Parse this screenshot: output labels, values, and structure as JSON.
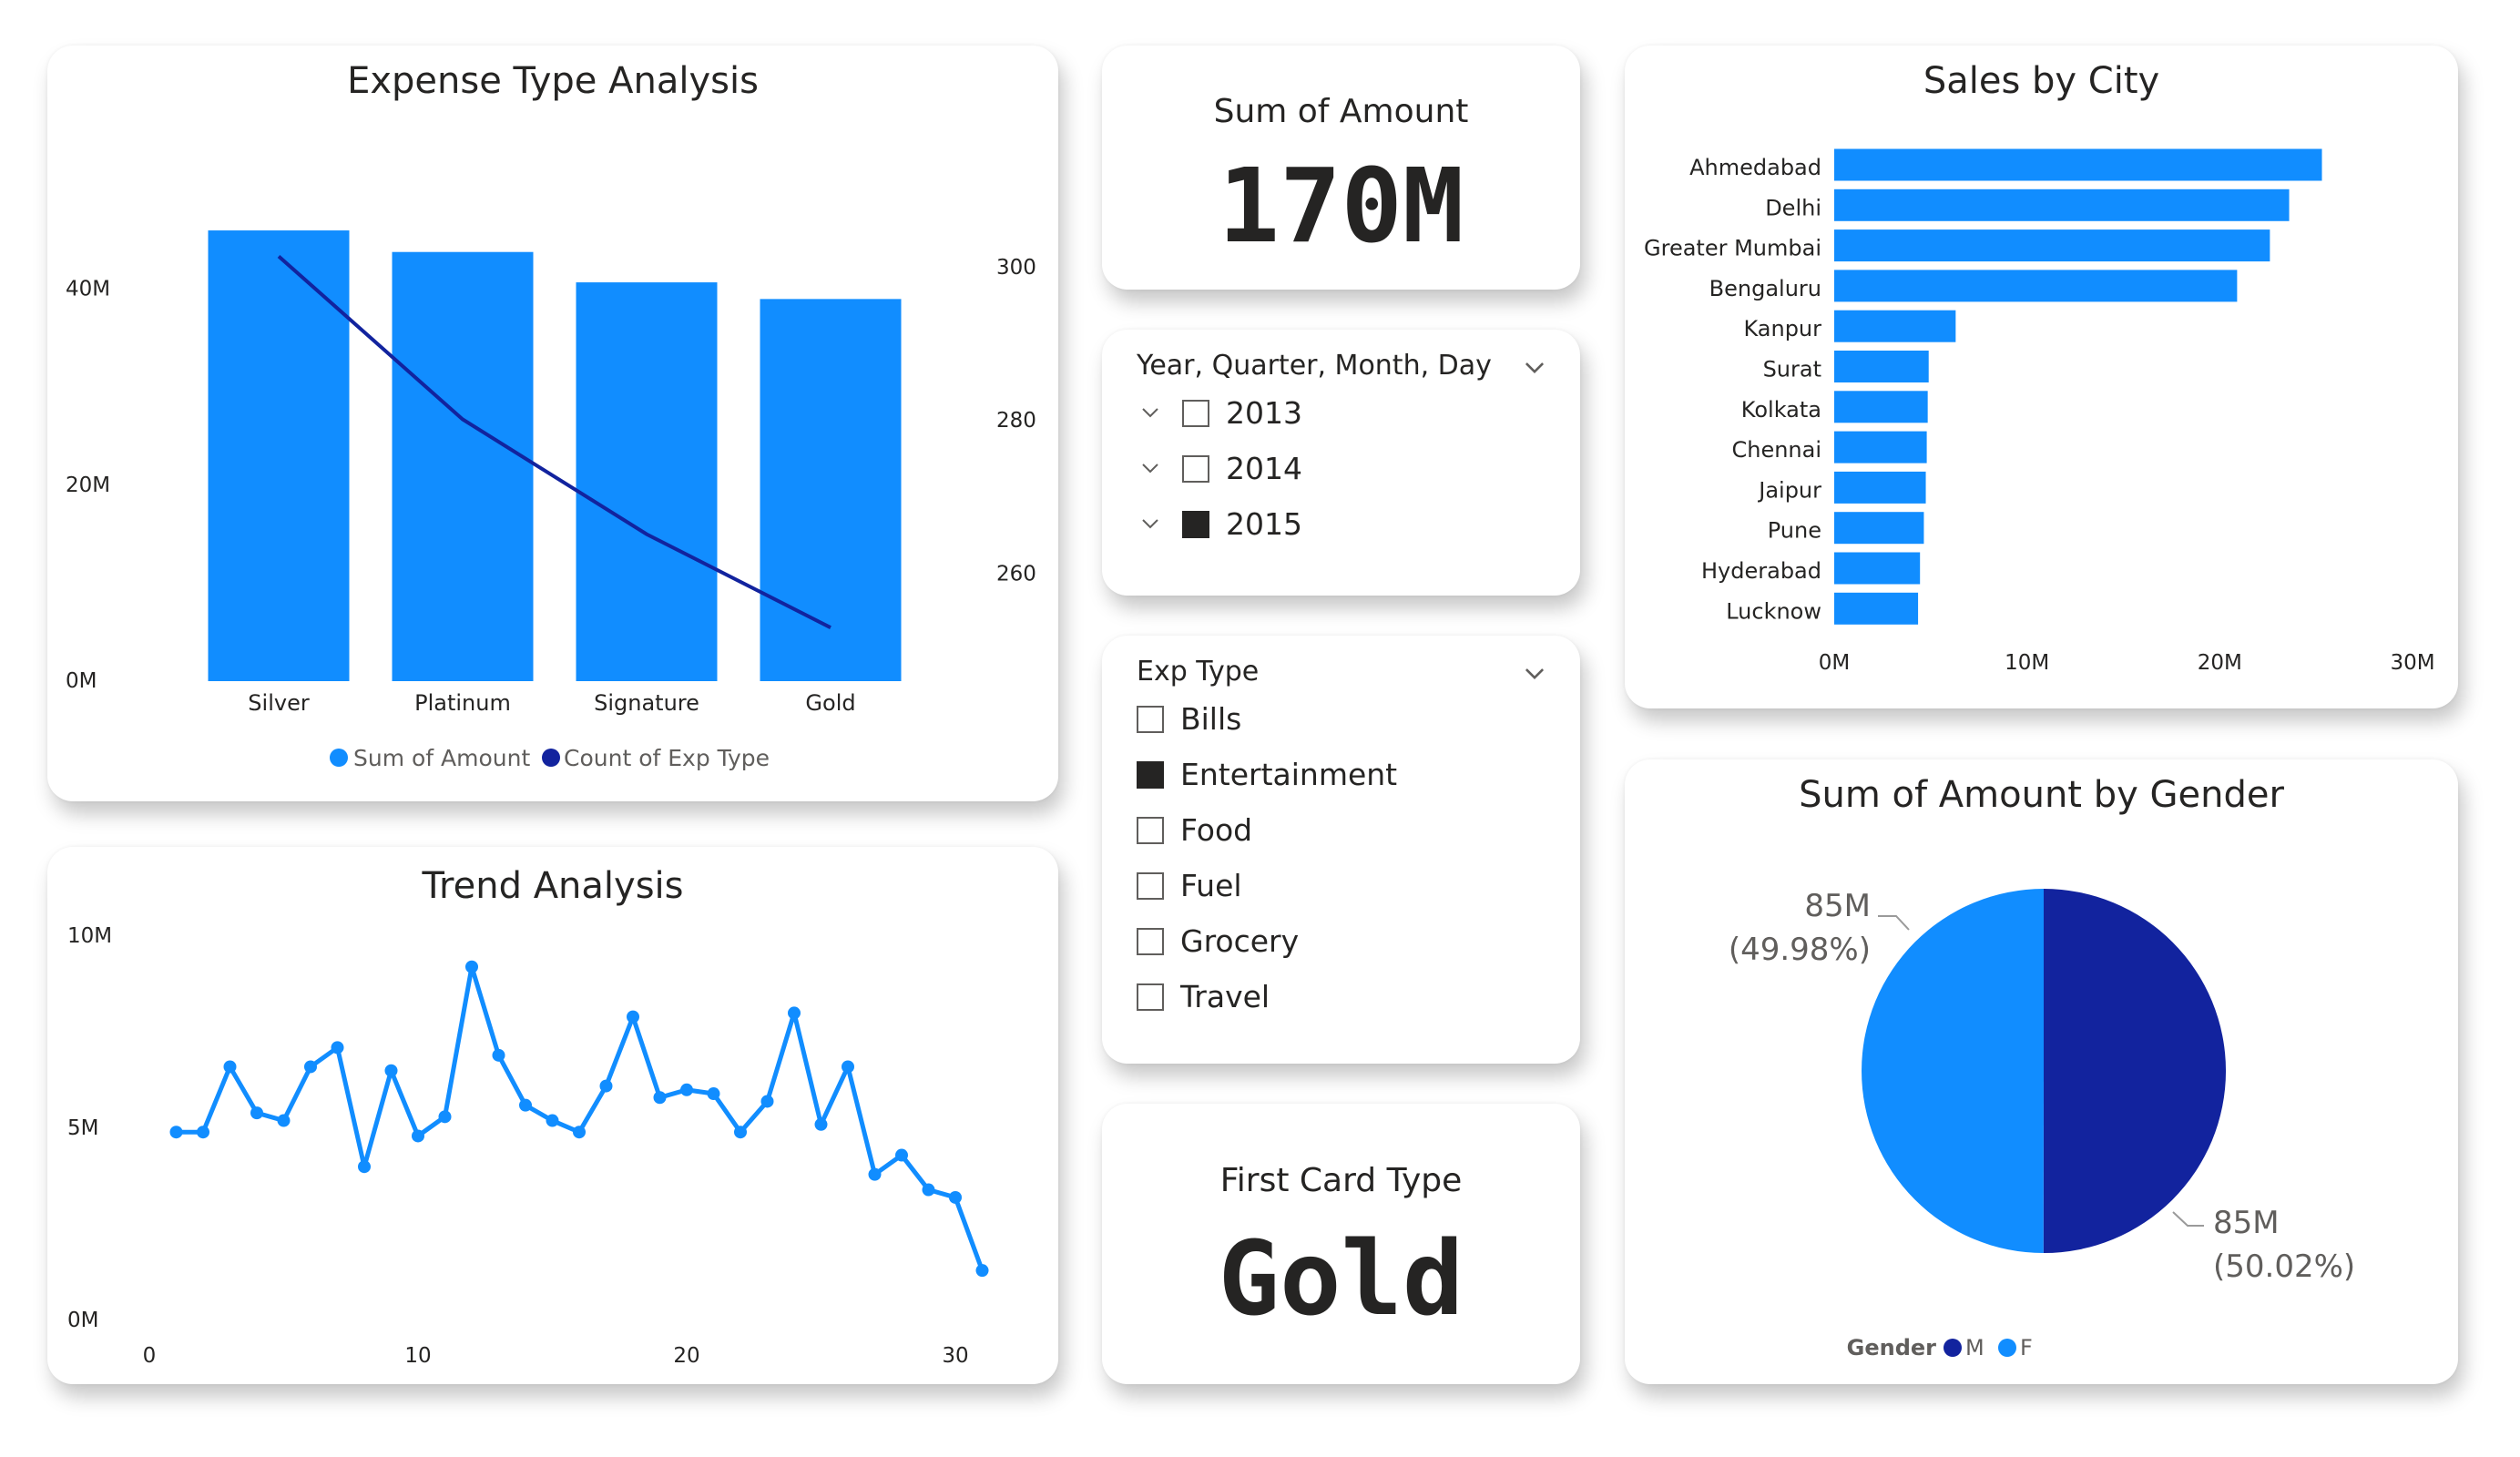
{
  "expense_chart": {
    "title": "Expense Type Analysis",
    "legend": [
      {
        "label": "Sum of Amount",
        "color": "#118DFF"
      },
      {
        "label": "Count of Exp Type",
        "color": "#12239E"
      }
    ]
  },
  "trend_chart": {
    "title": "Trend Analysis"
  },
  "kpi_amount": {
    "label": "Sum of Amount",
    "value": "170M"
  },
  "kpi_card": {
    "label": "First Card Type",
    "value": "Gold"
  },
  "date_slicer": {
    "title": "Year, Quarter, Month, Day",
    "items": [
      {
        "label": "2013",
        "checked": false
      },
      {
        "label": "2014",
        "checked": false
      },
      {
        "label": "2015",
        "checked": true
      }
    ]
  },
  "exp_slicer": {
    "title": "Exp Type",
    "items": [
      {
        "label": "Bills",
        "checked": false
      },
      {
        "label": "Entertainment",
        "checked": true
      },
      {
        "label": "Food",
        "checked": false
      },
      {
        "label": "Fuel",
        "checked": false
      },
      {
        "label": "Grocery",
        "checked": false
      },
      {
        "label": "Travel",
        "checked": false
      }
    ]
  },
  "city_chart": {
    "title": "Sales by City"
  },
  "gender_chart": {
    "title": "Sum of Amount by Gender",
    "legend_title": "Gender",
    "labels": [
      {
        "value": "85M",
        "pct": "(49.98%)"
      },
      {
        "value": "85M",
        "pct": "(50.02%)"
      }
    ]
  },
  "chart_data": [
    {
      "type": "bar",
      "title": "Expense Type Analysis",
      "categories": [
        "Silver",
        "Platinum",
        "Signature",
        "Gold"
      ],
      "series": [
        {
          "name": "Sum of Amount",
          "axis": "left",
          "values": [
            46000000,
            43800000,
            40700000,
            39000000
          ]
        },
        {
          "name": "Count of Exp Type",
          "type": "line",
          "axis": "right",
          "values": [
            301.5,
            280.2,
            265.2,
            253.0
          ]
        }
      ],
      "y_ticks": [
        "0M",
        "20M",
        "40M"
      ],
      "ylim": [
        0,
        50000000
      ],
      "y2_ticks": [
        "260",
        "280",
        "300"
      ],
      "y2lim": [
        246,
        310
      ],
      "legend": "bottom-center"
    },
    {
      "type": "line",
      "title": "Trend Analysis",
      "x": [
        1,
        2,
        3,
        4,
        5,
        6,
        7,
        8,
        9,
        10,
        11,
        12,
        13,
        14,
        15,
        16,
        17,
        18,
        19,
        20,
        21,
        22,
        23,
        24,
        25,
        26,
        27,
        28,
        29,
        30,
        31
      ],
      "values": [
        4.9,
        4.9,
        6.6,
        5.4,
        5.2,
        6.6,
        7.1,
        4.0,
        6.5,
        4.8,
        5.3,
        9.2,
        6.9,
        5.6,
        5.2,
        4.9,
        6.1,
        7.9,
        5.8,
        6.0,
        5.9,
        4.9,
        5.7,
        8.0,
        5.1,
        6.6,
        3.8,
        4.3,
        3.4,
        3.2,
        1.3
      ],
      "y_unit": "M",
      "x_ticks": [
        "0",
        "10",
        "20",
        "30"
      ],
      "xlim": [
        0,
        32
      ],
      "y_ticks": [
        "0M",
        "5M",
        "10M"
      ],
      "ylim": [
        0,
        10
      ]
    },
    {
      "type": "bar",
      "orientation": "horizontal",
      "title": "Sales by City",
      "categories": [
        "Ahmedabad",
        "Delhi",
        "Greater Mumbai",
        "Bengaluru",
        "Kanpur",
        "Surat",
        "Kolkata",
        "Chennai",
        "Jaipur",
        "Pune",
        "Hyderabad",
        "Lucknow"
      ],
      "values": [
        25.3,
        23.6,
        22.6,
        20.9,
        6.3,
        4.9,
        4.85,
        4.8,
        4.75,
        4.65,
        4.45,
        4.35
      ],
      "unit": "M",
      "x_ticks": [
        "0M",
        "10M",
        "20M",
        "30M"
      ],
      "xlim": [
        0,
        30
      ]
    },
    {
      "type": "pie",
      "title": "Sum of Amount by Gender",
      "legend_title": "Gender",
      "slices": [
        {
          "label": "M",
          "value": 50.02,
          "color": "#12239E"
        },
        {
          "label": "F",
          "value": 49.98,
          "color": "#118DFF"
        }
      ],
      "legend": "bottom-center"
    }
  ]
}
